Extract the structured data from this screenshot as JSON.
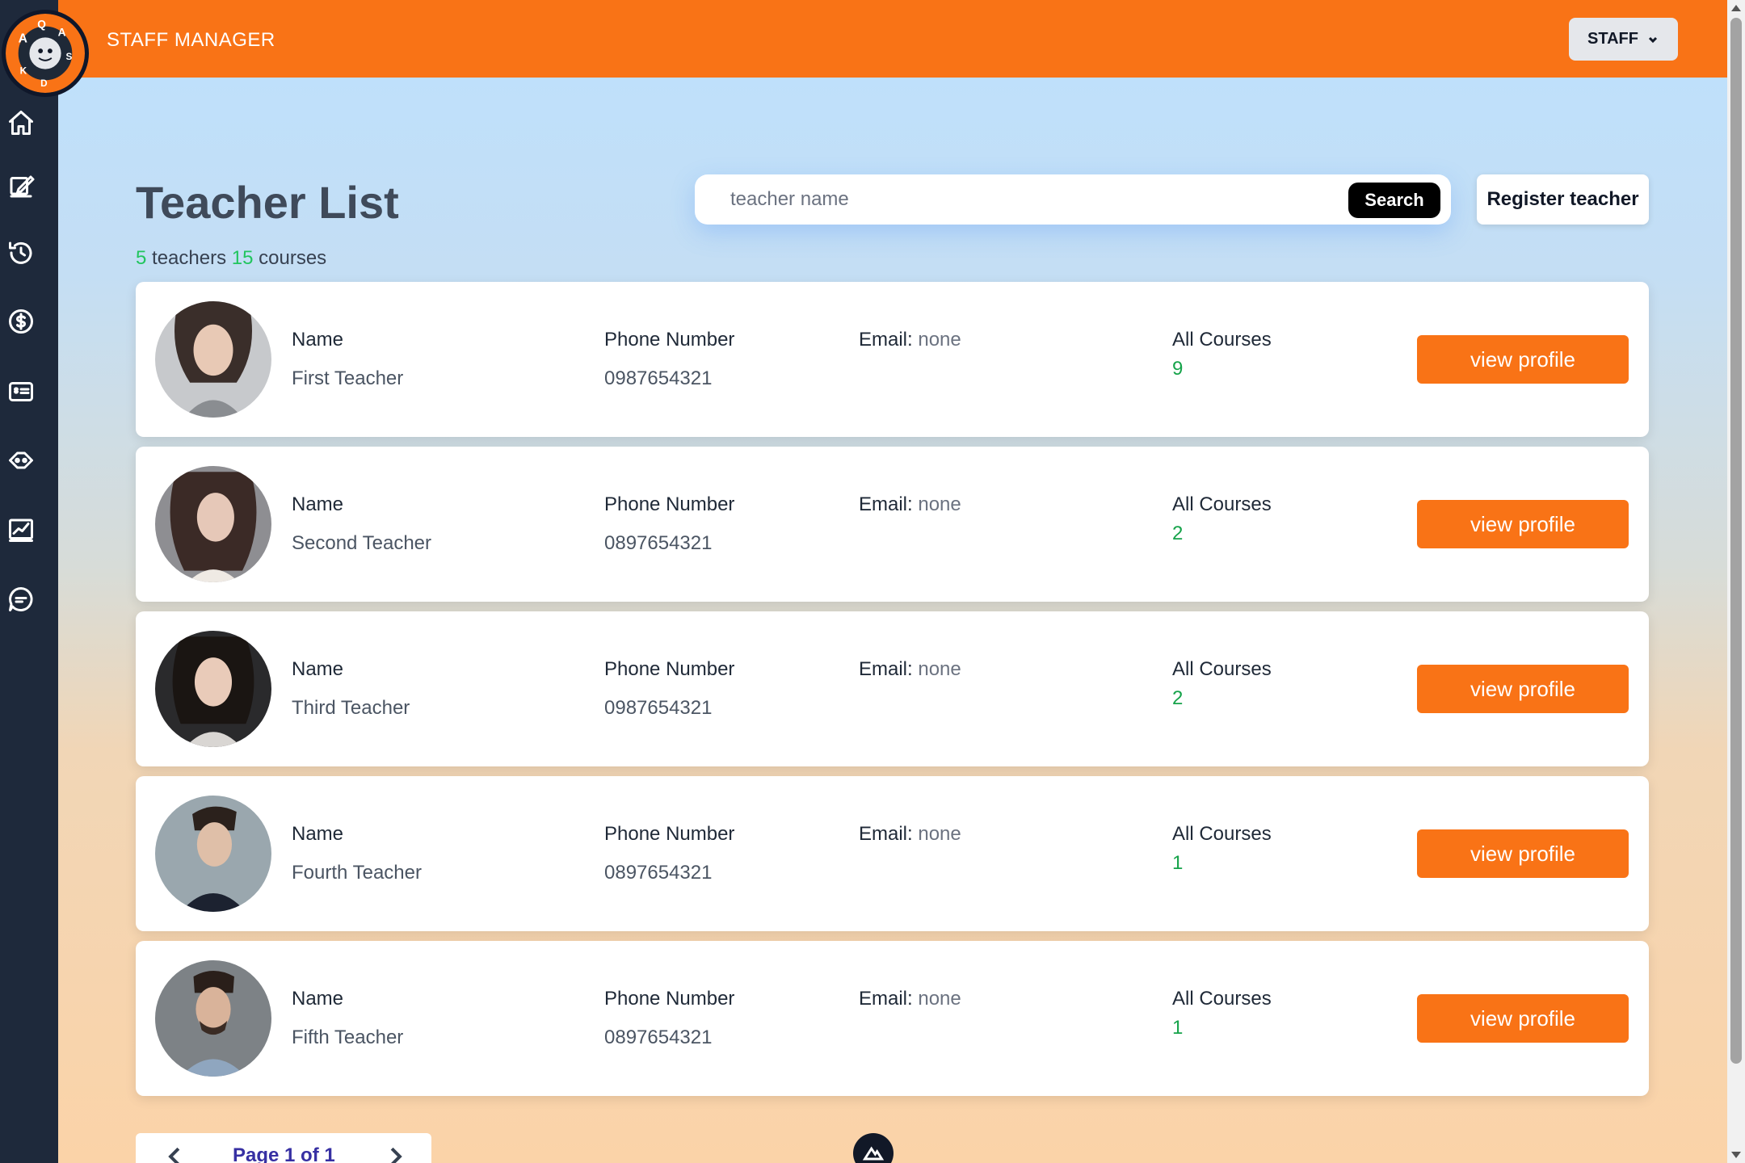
{
  "header": {
    "brand": "STAFF MANAGER",
    "logo_letters": "AQUA KIDS",
    "staff_menu_label": "STAFF",
    "staff_menu_icon": "chevron-down-icon"
  },
  "sidebar": {
    "items": [
      {
        "icon": "home-icon"
      },
      {
        "icon": "edit-icon"
      },
      {
        "icon": "history-icon"
      },
      {
        "icon": "dollar-circle-icon"
      },
      {
        "icon": "id-card-icon"
      },
      {
        "icon": "palette-icon"
      },
      {
        "icon": "chart-icon"
      },
      {
        "icon": "chat-icon"
      }
    ]
  },
  "main": {
    "title": "Teacher List",
    "teacher_count": "5",
    "teacher_word": "teachers",
    "course_count": "15",
    "course_word": "courses",
    "search": {
      "placeholder": "teacher name",
      "value": "",
      "button_label": "Search"
    },
    "register_label": "Register teacher",
    "columns": {
      "name": "Name",
      "phone": "Phone Number",
      "email": "Email:",
      "courses": "All Courses"
    },
    "teachers": [
      {
        "name": "First Teacher",
        "phone": "0987654321",
        "email": "none",
        "courses": "9",
        "button": "view profile"
      },
      {
        "name": "Second Teacher",
        "phone": "0897654321",
        "email": "none",
        "courses": "2",
        "button": "view profile"
      },
      {
        "name": "Third Teacher",
        "phone": "0987654321",
        "email": "none",
        "courses": "2",
        "button": "view profile"
      },
      {
        "name": "Fourth Teacher",
        "phone": "0897654321",
        "email": "none",
        "courses": "1",
        "button": "view profile"
      },
      {
        "name": "Fifth Teacher",
        "phone": "0897654321",
        "email": "none",
        "courses": "1",
        "button": "view profile"
      }
    ],
    "pagination": {
      "label": "Page 1 of 1",
      "prev_icon": "chevron-left-icon",
      "next_icon": "chevron-right-icon"
    }
  },
  "colors": {
    "topbar": "#f97316",
    "sidebar": "#1e293b",
    "accent_button": "#f97316",
    "count_green": "#22c55e",
    "course_green": "#16a34a",
    "pager_text": "#3730a3"
  }
}
